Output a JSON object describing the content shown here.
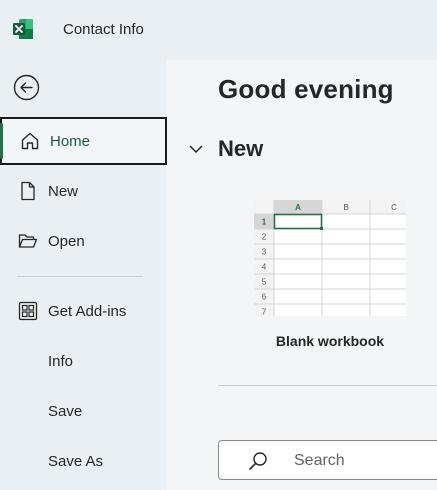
{
  "window": {
    "title": "Contact Info",
    "app_icon": "excel-icon"
  },
  "sidebar": {
    "back_icon": "back-arrow-icon",
    "items": [
      {
        "label": "Home",
        "icon": "home-icon",
        "selected": true
      },
      {
        "label": "New",
        "icon": "new-document-icon"
      },
      {
        "label": "Open",
        "icon": "folder-open-icon"
      },
      {
        "label": "Get Add-ins",
        "icon": "add-ins-icon"
      },
      {
        "label": "Info"
      },
      {
        "label": "Save"
      },
      {
        "label": "Save As"
      }
    ]
  },
  "main": {
    "greeting": "Good evening",
    "new_section": {
      "title": "New",
      "toggle_icon": "chevron-down-icon",
      "templates": [
        {
          "label": "Blank workbook",
          "thumbnail": {
            "columns": [
              "A",
              "B",
              "C"
            ],
            "rows": [
              "1",
              "2",
              "3",
              "4",
              "5",
              "6",
              "7"
            ]
          }
        }
      ]
    },
    "search": {
      "placeholder": "Search",
      "icon": "search-icon"
    }
  },
  "colors": {
    "accent": "#217346",
    "accent_text": "#185c37",
    "sidebar_bg": "#e9eff2",
    "main_bg": "#f3f5f6"
  }
}
